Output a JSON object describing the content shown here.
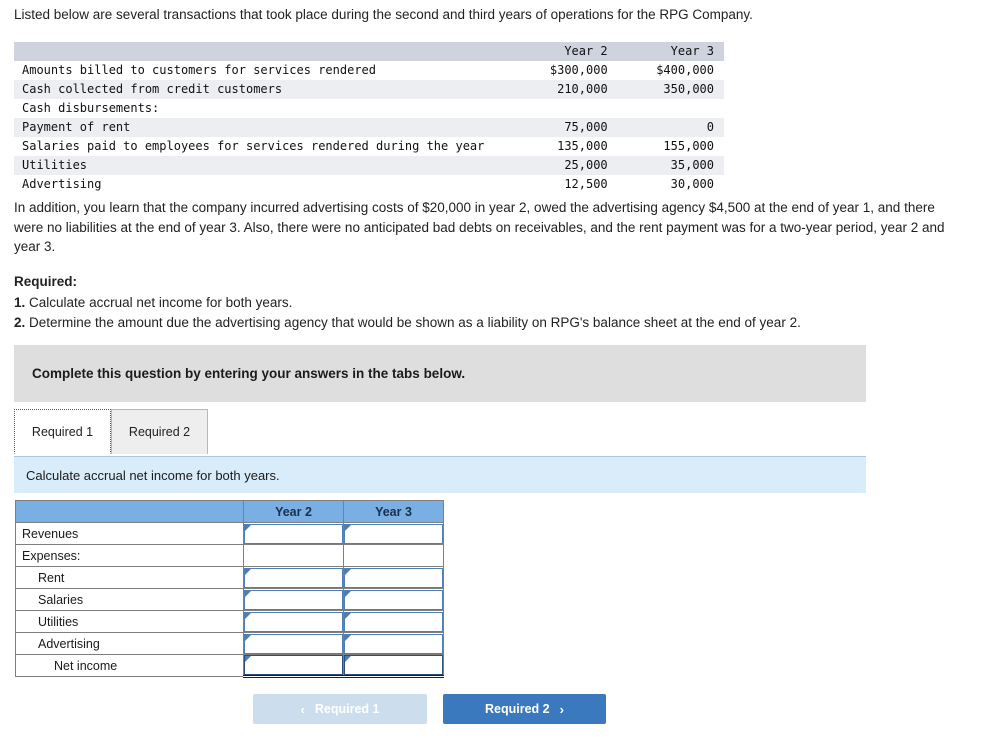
{
  "intro": {
    "text": "Listed below are several transactions that took place during the second and third years of operations for the RPG Company."
  },
  "transactions_table": {
    "columns": [
      "",
      "Year 2",
      "Year 3"
    ],
    "rows": [
      {
        "label": "Amounts billed to customers for services rendered",
        "year2": "$300,000",
        "year3": "$400,000"
      },
      {
        "label": "Cash collected from credit customers",
        "year2": "210,000",
        "year3": "350,000"
      },
      {
        "label": "Cash disbursements:",
        "year2": "",
        "year3": ""
      },
      {
        "label": "Payment of rent",
        "year2": "75,000",
        "year3": "0"
      },
      {
        "label": "Salaries paid to employees for services rendered during the year",
        "year2": "135,000",
        "year3": "155,000"
      },
      {
        "label": "Utilities",
        "year2": "25,000",
        "year3": "35,000"
      },
      {
        "label": "Advertising",
        "year2": "12,500",
        "year3": "30,000"
      }
    ]
  },
  "additional_info": {
    "text": "In addition, you learn that the company incurred advertising costs of $20,000 in year 2, owed the advertising agency $4,500 at the end of year 1, and there were no liabilities at the end of year 3. Also, there were no anticipated bad debts on receivables, and the rent payment was for a two-year period, year 2 and year 3."
  },
  "required": {
    "title": "Required:",
    "items": [
      {
        "num": "1.",
        "text": "Calculate accrual net income for both years."
      },
      {
        "num": "2.",
        "text": "Determine the amount due the advertising agency that would be shown as a liability on RPG's balance sheet at the end of year 2."
      }
    ]
  },
  "instruction_banner": {
    "text": "Complete this question by entering your answers in the tabs below."
  },
  "tabs": [
    {
      "label": "Required 1",
      "active": true
    },
    {
      "label": "Required 2",
      "active": false
    }
  ],
  "sub_instruction": {
    "text": "Calculate accrual net income for both years."
  },
  "answer_table": {
    "columns": [
      "",
      "Year 2",
      "Year 3"
    ],
    "rows": [
      {
        "label": "Revenues",
        "indent": 0,
        "input": true,
        "total": false,
        "year2": "",
        "year3": ""
      },
      {
        "label": "Expenses:",
        "indent": 0,
        "input": false,
        "total": false,
        "year2": "",
        "year3": ""
      },
      {
        "label": "Rent",
        "indent": 1,
        "input": true,
        "total": false,
        "year2": "",
        "year3": ""
      },
      {
        "label": "Salaries",
        "indent": 1,
        "input": true,
        "total": false,
        "year2": "",
        "year3": ""
      },
      {
        "label": "Utilities",
        "indent": 1,
        "input": true,
        "total": false,
        "year2": "",
        "year3": ""
      },
      {
        "label": "Advertising",
        "indent": 1,
        "input": true,
        "total": false,
        "year2": "",
        "year3": ""
      },
      {
        "label": "Net income",
        "indent": 2,
        "input": true,
        "total": true,
        "year2": "",
        "year3": ""
      }
    ]
  },
  "navigation": {
    "prev": {
      "label": "Required 1",
      "chevron": "‹",
      "disabled": true
    },
    "next": {
      "label": "Required 2",
      "chevron": "›",
      "disabled": false
    }
  },
  "colors": {
    "header_blue": "#7aafe3",
    "button_blue": "#3b79bf",
    "button_disabled": "#ccdded",
    "banner_gray": "#dedede",
    "instruction_blue": "#d9ecfa",
    "txn_header_gray": "#ced3de",
    "txn_stripe": "#eceef2",
    "input_border": "#4e80b5"
  }
}
